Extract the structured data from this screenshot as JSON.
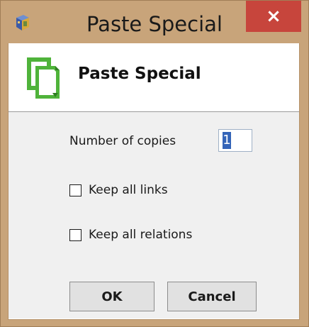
{
  "window": {
    "title": "Paste Special",
    "close_glyph": "×",
    "app_icon": "app-icon",
    "colors": {
      "frame": "#c8a47a",
      "close_button": "#c7453c",
      "content_bg": "#f0f0f0",
      "header_icon_green": "#4fb33a",
      "selection": "#3464b8"
    }
  },
  "header": {
    "icon": "paste-document-icon",
    "title": "Paste Special"
  },
  "form": {
    "copies_label": "Number of copies",
    "copies_value": "1",
    "keep_links_label": "Keep all links",
    "keep_links_checked": false,
    "keep_relations_label": "Keep all relations",
    "keep_relations_checked": false
  },
  "buttons": {
    "ok_label": "OK",
    "cancel_label": "Cancel"
  }
}
